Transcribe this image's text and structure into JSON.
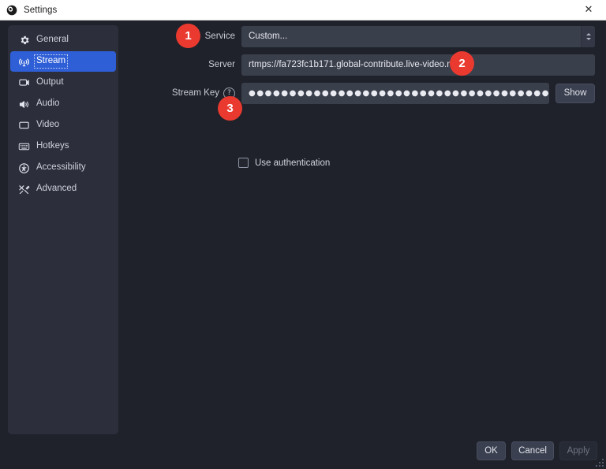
{
  "titlebar": {
    "title": "Settings",
    "app_icon": "obs-logo-icon",
    "close_label": "✕"
  },
  "sidebar": {
    "items": [
      {
        "label": "General",
        "icon": "gear-icon",
        "selected": false
      },
      {
        "label": "Stream",
        "icon": "broadcast-icon",
        "selected": true
      },
      {
        "label": "Output",
        "icon": "output-screen-icon",
        "selected": false
      },
      {
        "label": "Audio",
        "icon": "speaker-icon",
        "selected": false
      },
      {
        "label": "Video",
        "icon": "monitor-icon",
        "selected": false
      },
      {
        "label": "Hotkeys",
        "icon": "keyboard-icon",
        "selected": false
      },
      {
        "label": "Accessibility",
        "icon": "accessibility-icon",
        "selected": false
      },
      {
        "label": "Advanced",
        "icon": "tools-icon",
        "selected": false
      }
    ]
  },
  "stream_settings": {
    "service": {
      "label": "Service",
      "value": "Custom...",
      "dropdown_icon": "updown-chevron-icon"
    },
    "server": {
      "label": "Server",
      "value": "rtmps://fa723fc1b171.global-contribute.live-video.net",
      "placeholder": ""
    },
    "stream_key": {
      "label": "Stream Key",
      "help_icon": "question-mark-icon",
      "help_glyph": "?",
      "value": "●●●●●●●●●●●●●●●●●●●●●●●●●●●●●●●●●●●●●●●●●●●●●●●●●",
      "show_button": "Show"
    },
    "use_authentication": {
      "label": "Use authentication",
      "checked": false
    }
  },
  "annotations": [
    {
      "number": "1",
      "target": "service-row"
    },
    {
      "number": "2",
      "target": "server-field"
    },
    {
      "number": "3",
      "target": "stream-key-row"
    }
  ],
  "footer": {
    "ok": "OK",
    "cancel": "Cancel",
    "apply": "Apply",
    "apply_disabled": true
  },
  "colors": {
    "accent_blue": "#2f5fd6",
    "badge_red": "#ea3a30",
    "window_bg": "#1f222a",
    "sidebar_bg": "#2c2f3b",
    "input_bg": "#3a3f4c"
  }
}
